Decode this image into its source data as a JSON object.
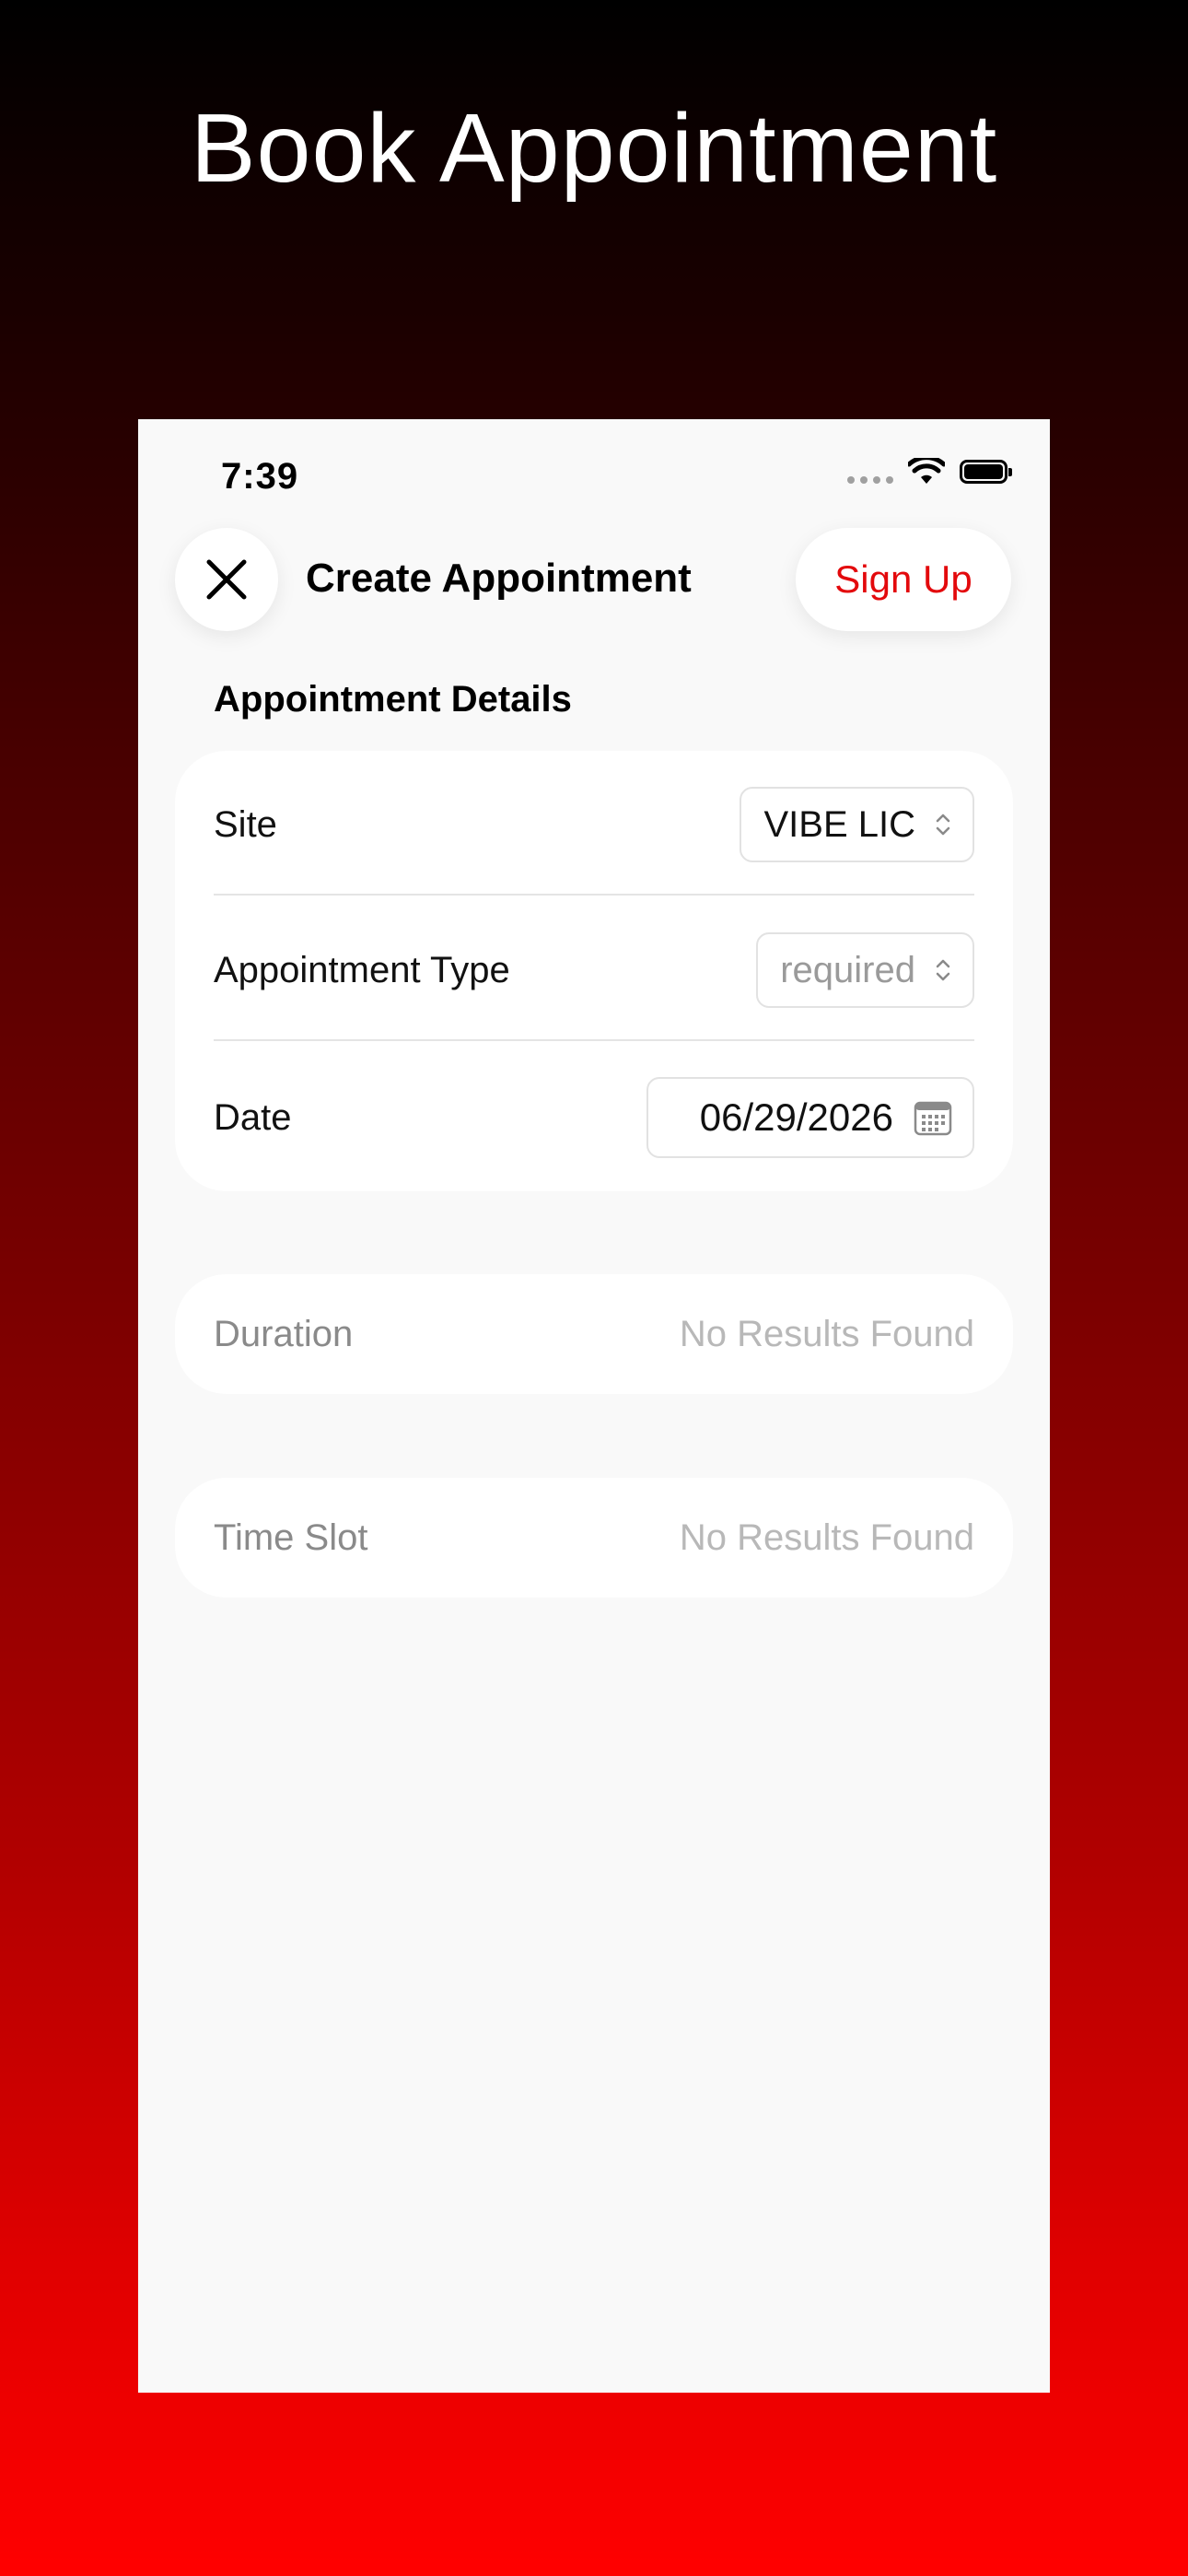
{
  "hero": {
    "title": "Book Appointment"
  },
  "status_bar": {
    "time": "7:39"
  },
  "nav": {
    "title": "Create Appointment",
    "signup_label": "Sign Up"
  },
  "section": {
    "title": "Appointment Details"
  },
  "form": {
    "site": {
      "label": "Site",
      "value": "VIBE LIC"
    },
    "appointment_type": {
      "label": "Appointment Type",
      "value": "required"
    },
    "date": {
      "label": "Date",
      "value": "06/29/2026"
    }
  },
  "duration": {
    "label": "Duration",
    "value": "No Results Found"
  },
  "time_slot": {
    "label": "Time Slot",
    "value": "No Results Found"
  },
  "colors": {
    "accent": "#e3090c",
    "background_top": "#000000",
    "background_bottom": "#ff0000"
  },
  "icons": [
    "close-icon",
    "wifi-icon",
    "battery-icon",
    "signal-icon",
    "chevron-up-down-icon",
    "calendar-icon"
  ]
}
